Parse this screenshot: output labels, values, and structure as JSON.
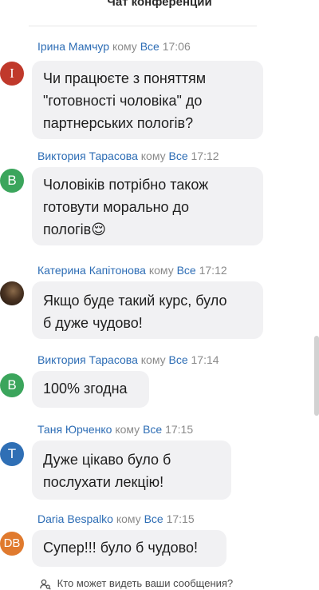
{
  "header": {
    "title": "Чат конференции"
  },
  "messages": [
    {
      "sender": "Ірина Мамчур",
      "to_word": "кому",
      "recipient": "Все",
      "time": "17:06",
      "avatar": {
        "letter": "I",
        "color": "#c0392b"
      },
      "lines": [
        "Чи працюєте з поняттям",
        "\"готовності чоловіка\" до",
        "партнерських пологів?"
      ]
    },
    {
      "sender": "Виктория Тарасова",
      "to_word": "кому",
      "recipient": "Все",
      "time": "17:12",
      "avatar": {
        "letter": "В",
        "color": "#3ba55c"
      },
      "lines": [
        "Чоловіків потрібно також",
        "готовути морально до",
        "пологів😌"
      ]
    },
    {
      "sender": "Катерина Капітонова",
      "to_word": "кому",
      "recipient": "Все",
      "time": "17:12",
      "avatar": {
        "letter": "",
        "color": "#3a2a1c"
      },
      "lines": [
        "Якщо буде такий курс, було",
        "б дуже чудово!"
      ]
    },
    {
      "sender": "Виктория Тарасова",
      "to_word": "кому",
      "recipient": "Все",
      "time": "17:14",
      "avatar": {
        "letter": "В",
        "color": "#3ba55c"
      },
      "lines": [
        "100% згодна"
      ]
    },
    {
      "sender": "Таня Юрченко",
      "to_word": "кому",
      "recipient": "Все",
      "time": "17:15",
      "avatar": {
        "letter": "Т",
        "color": "#2f6fb5"
      },
      "lines": [
        "Дуже цікаво було б",
        "послухати лекцію!"
      ]
    },
    {
      "sender": "Daria Bespalko",
      "to_word": "кому",
      "recipient": "Все",
      "time": "17:15",
      "avatar": {
        "letter": "DB",
        "color": "#e07a2e"
      },
      "lines": [
        "Супер!!! було б чудово!"
      ]
    }
  ],
  "footer": {
    "text": "Кто может видеть ваши сообщения?"
  }
}
